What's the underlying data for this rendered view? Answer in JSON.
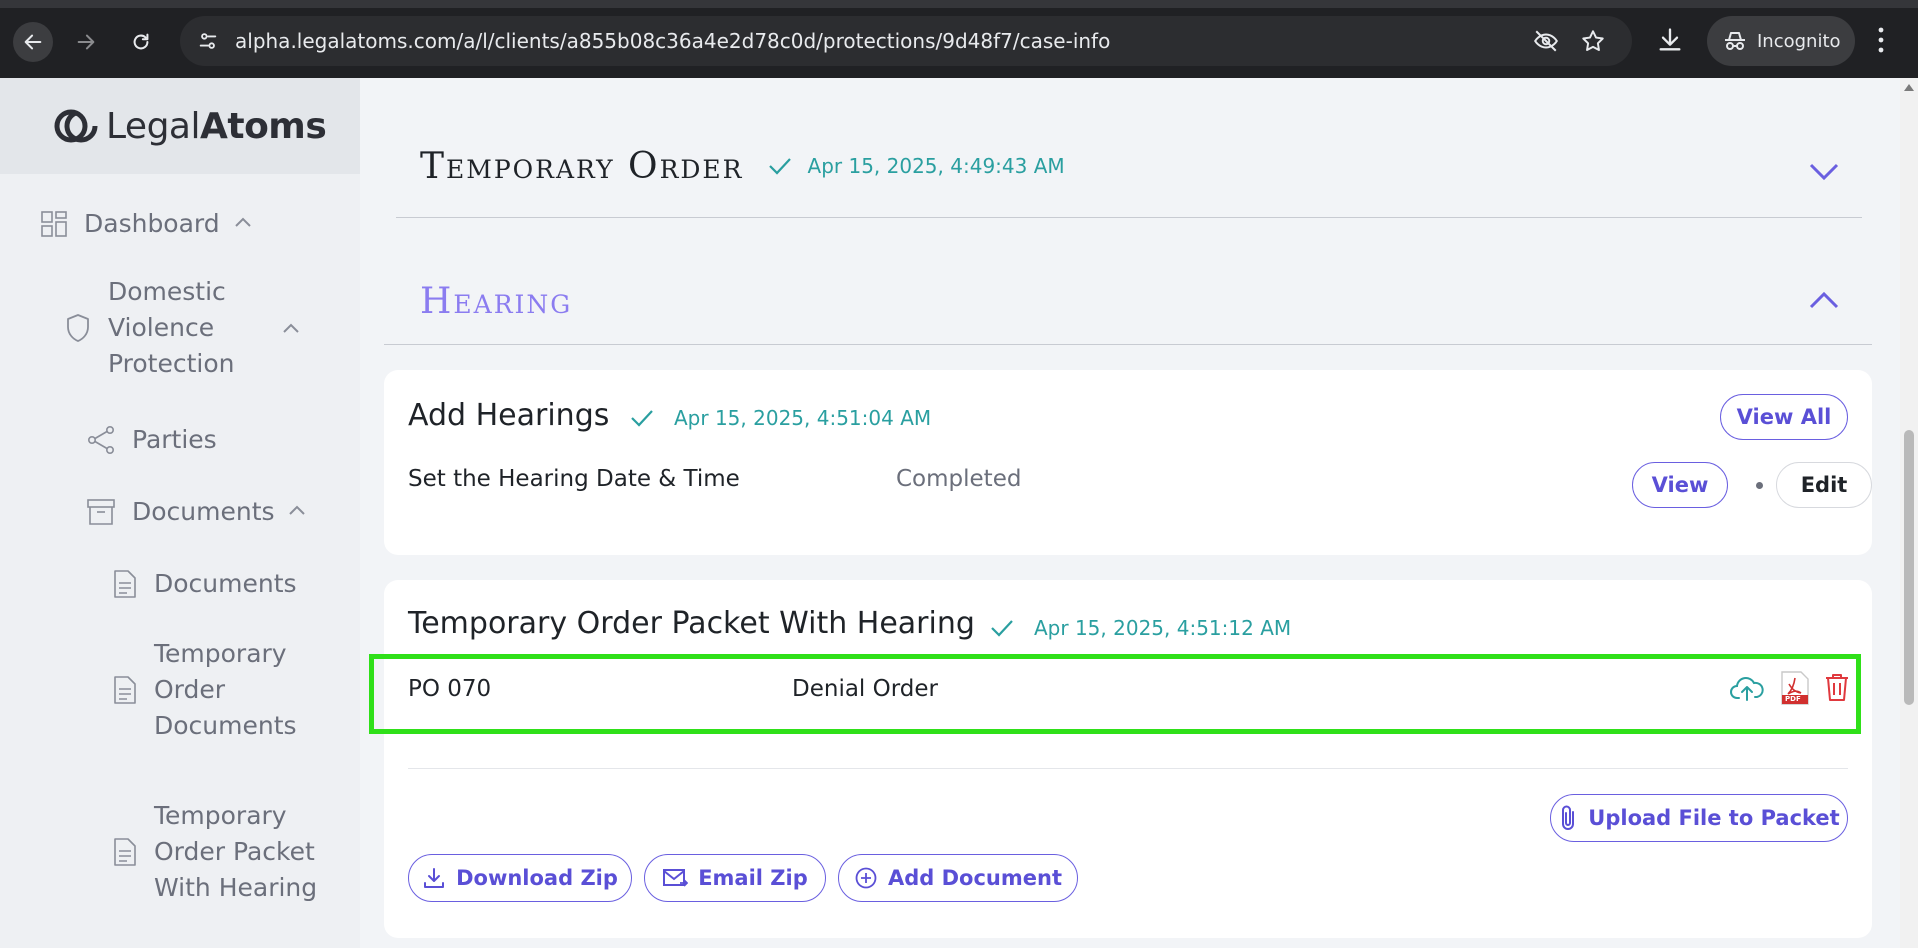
{
  "browser": {
    "url": "alpha.legalatoms.com/a/l/clients/a855b08c36a4e2d78c0d/protections/9d48f7/case-info",
    "incognito_label": "Incognito"
  },
  "sidebar": {
    "logo": {
      "regular": "Legal",
      "bold": "Atoms"
    },
    "items": [
      {
        "label": "Dashboard"
      },
      {
        "label": "Domestic Violence Protection"
      },
      {
        "label": "Parties"
      },
      {
        "label": "Documents"
      },
      {
        "label": "Documents"
      },
      {
        "label": "Temporary Order Documents"
      },
      {
        "label": "Temporary Order Packet With Hearing"
      }
    ]
  },
  "main": {
    "temporary_order": {
      "title": "Temporary Order",
      "date": "Apr 15, 2025, 4:49:43 AM"
    },
    "hearing": {
      "title": "Hearing"
    },
    "add_hearings": {
      "title": "Add Hearings",
      "date": "Apr 15, 2025, 4:51:04 AM",
      "view_all": "View All",
      "task": "Set the Hearing Date & Time",
      "status": "Completed",
      "view": "View",
      "edit": "Edit"
    },
    "packet": {
      "title": "Temporary Order Packet With Hearing",
      "date": "Apr 15, 2025, 4:51:12 AM",
      "doc_code": "PO 070",
      "doc_name": "Denial Order",
      "pdf_label": "PDF",
      "upload_file": "Upload File to Packet",
      "download_zip": "Download Zip",
      "email_zip": "Email Zip",
      "add_document": "Add Document"
    }
  },
  "colors": {
    "accent": "#6a5fe0",
    "teal": "#2a9fa0",
    "highlight": "#2fe019",
    "danger": "#e0393e"
  }
}
